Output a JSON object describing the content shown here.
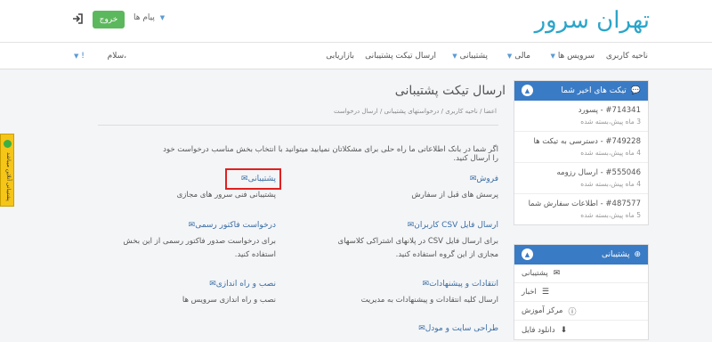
{
  "header": {
    "logo": "تهران سرور",
    "logout_label": "خروج",
    "messages_label": "پیام ها"
  },
  "nav": {
    "items": [
      "ناحیه کاربری",
      "سرویس ها",
      "مالی",
      "پشتیبانی",
      "ارسال تیکت پشتیبانی",
      "بازاریابی"
    ],
    "greeting": "سلام،",
    "greeting_mark": "!"
  },
  "recent_tickets": {
    "title": "تیکت های اخیر شما",
    "items": [
      {
        "title": "#714341 - پسورد",
        "time": "3 ماه پیش،بسته شده"
      },
      {
        "title": "#749228 - دسترسی به تیکت ها",
        "time": "4 ماه پیش،بسته شده"
      },
      {
        "title": "#555046 - ارسال رزومه",
        "time": "4 ماه پیش،بسته شده"
      },
      {
        "title": "#487577 - اطلاعات سفارش شما",
        "time": "5 ماه پیش،بسته شده"
      }
    ]
  },
  "support_panel": {
    "title": "پشتیبانی",
    "items": [
      {
        "label": "پشتیبانی",
        "icon": "envelope-icon"
      },
      {
        "label": "اخبار",
        "icon": "list-icon"
      },
      {
        "label": "مرکز آموزش",
        "icon": "info-icon"
      },
      {
        "label": "دانلود فایل",
        "icon": "download-icon"
      }
    ]
  },
  "main": {
    "title": "ارسال تیکت پشتیبانی",
    "breadcrumb": "اعضا / ناحیه کاربری / درخواستهای پشتیبانی / ارسال درخواست",
    "intro": "اگر شما در بانک اطلاعاتی ما راه حلی برای مشکلاتان نمیابید میتوانید با انتخاب بخش مناسب درخواست خود را ارسال کنید.",
    "departments": [
      {
        "title": "فروش",
        "desc": "پرسش های قبل از سفارش"
      },
      {
        "title": "پشتیبانی",
        "desc": "پشتیبانی فنی سرور های مجازی"
      },
      {
        "title": "ارسال فایل CSV کاربران",
        "desc": "برای ارسال فایل CSV در پلانهای اشتراکی کلاسهای مجازی از این گروه استفاده کنید."
      },
      {
        "title": "درخواست فاکتور رسمی",
        "desc": "برای درخواست صدور فاکتور رسمی از این بخش استفاده کنید."
      },
      {
        "title": "انتقادات و پیشنهادات",
        "desc": "ارسال کلیه انتقادات و پیشنهادات به مدیریت"
      },
      {
        "title": "نصب و راه اندازی",
        "desc": "نصب و راه اندازی سرویس ها"
      },
      {
        "title": "طراحی سایت و مودل",
        "desc": ""
      }
    ]
  },
  "side_tab": {
    "label": "پشتیبانی آنلاین میباشد"
  },
  "colors": {
    "brand": "#2aa5c9",
    "panel_head": "#3a7bc5",
    "logout_btn": "#5cb85c",
    "highlight": "#e02020",
    "link": "#3a6ea5"
  }
}
